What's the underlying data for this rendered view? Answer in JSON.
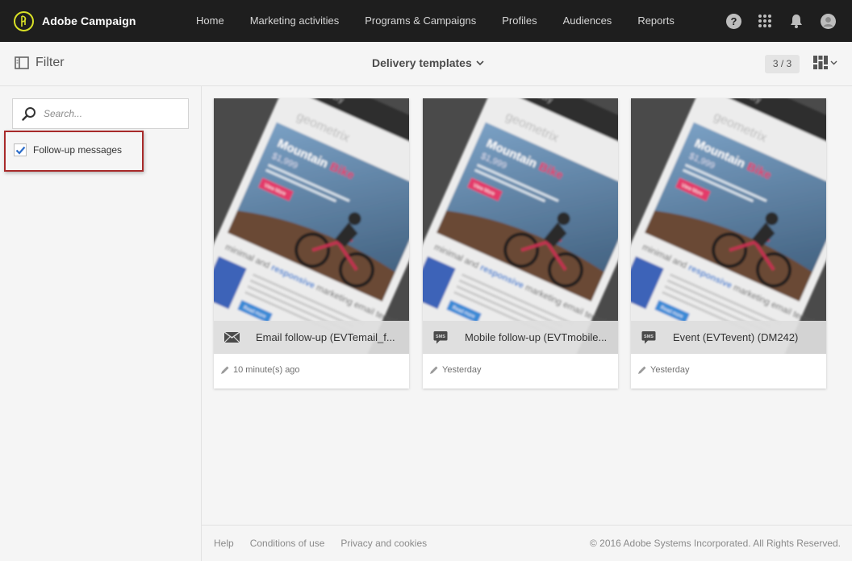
{
  "brand": {
    "name": "Adobe Campaign",
    "accent": "#d8e026"
  },
  "nav": {
    "items": [
      {
        "label": "Home"
      },
      {
        "label": "Marketing activities"
      },
      {
        "label": "Programs & Campaigns"
      },
      {
        "label": "Profiles"
      },
      {
        "label": "Audiences"
      },
      {
        "label": "Reports"
      }
    ]
  },
  "top_icons": [
    "help-icon",
    "apps-grid-icon",
    "notification-bell-icon",
    "user-avatar-icon"
  ],
  "subbar": {
    "filter_label": "Filter",
    "view_title": "Delivery templates",
    "count": "3 / 3"
  },
  "filter": {
    "search_placeholder": "Search...",
    "checkbox_label": "Follow-up messages",
    "checkbox_checked": true
  },
  "cards": [
    {
      "title": "Email follow-up (EVTemail_f...",
      "icon": "email-icon",
      "date": "10 minute(s) ago"
    },
    {
      "title": "Mobile follow-up (EVTmobile...",
      "icon": "sms-icon",
      "date": "Yesterday"
    },
    {
      "title": "Event (EVTevent) (DM242)",
      "icon": "sms-icon",
      "date": "Yesterday"
    }
  ],
  "thumb_text": {
    "app_label": "delivery",
    "brand": "geometrix",
    "headline_a": "Mountain",
    "headline_b": "Bike",
    "price": "$1,999",
    "cta": "View More",
    "tag_a": "minimal and",
    "tag_b": "responsive",
    "tag_c": "marketing email template",
    "more": "Read more"
  },
  "footer": {
    "help": "Help",
    "conditions": "Conditions of use",
    "privacy": "Privacy and cookies",
    "copyright": "© 2016 Adobe Systems Incorporated. All Rights Reserved."
  }
}
